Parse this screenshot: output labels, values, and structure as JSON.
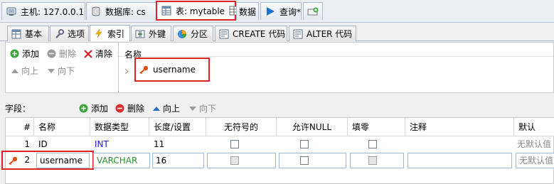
{
  "colors": {
    "highlight": "#e0232b",
    "type_int": "#1a1adc",
    "type_varchar": "#2a8f2a"
  },
  "top_tabs": {
    "host": "主机: 127.0.0.1",
    "database": "数据库: cs",
    "table": "表: mytable",
    "data": "数据",
    "query": "查询*"
  },
  "sub_tabs": [
    "基本",
    "选项",
    "索引",
    "外键",
    "分区",
    "CREATE 代码",
    "ALTER 代码"
  ],
  "index_toolbar": {
    "add": "添加",
    "delete": "删除",
    "clear": "清除",
    "up": "向上",
    "down": "向下"
  },
  "index_tree": {
    "header": "名称",
    "item": "username"
  },
  "fields_toolbar": {
    "label": "字段：",
    "add": "添加",
    "delete": "删除",
    "up": "向上",
    "down": "向下"
  },
  "grid": {
    "columns": [
      "#",
      "名称",
      "数据类型",
      "长度/设置",
      "无符号的",
      "允许NULL",
      "填零",
      "注释",
      "默认"
    ],
    "rows": [
      {
        "num": "1",
        "name": "ID",
        "type": "INT",
        "length": "11",
        "default": "无默认值"
      },
      {
        "num": "2",
        "name": "username",
        "type": "VARCHAR",
        "length": "16",
        "default": "无默认值"
      }
    ]
  }
}
